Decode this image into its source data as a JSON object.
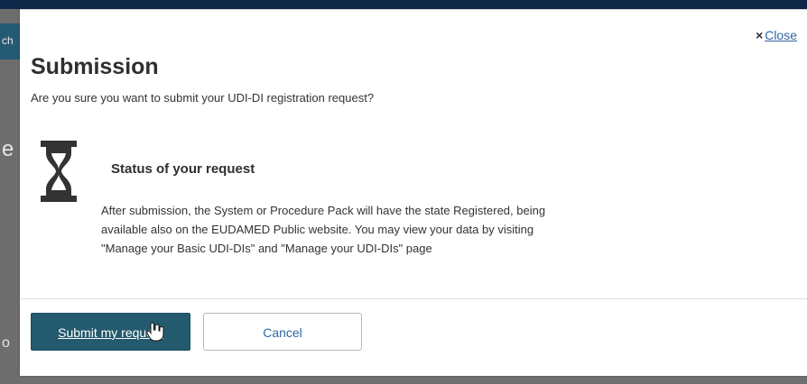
{
  "background": {
    "left_fragments": [
      "ch",
      "e",
      "o"
    ]
  },
  "dialog": {
    "close_label": "Close",
    "title": "Submission",
    "question": "Are you sure you want to submit your UDI-DI registration request?",
    "status": {
      "heading": "Status of your request",
      "lines": [
        "After submission, the System or Procedure Pack will have the state Registered, being",
        "available also on the EUDAMED Public website. You may view your data by visiting",
        "\"Manage your Basic UDI-DIs\" and \"Manage your UDI-DIs\" page"
      ]
    },
    "buttons": {
      "submit_label": "Submit my request",
      "cancel_label": "Cancel"
    }
  },
  "icons": {
    "close": "close-icon",
    "status": "hourglass-icon",
    "cursor": "hand-cursor-icon"
  },
  "colors": {
    "primary_button": "#245a6d",
    "link": "#2f67a5",
    "header_strip": "#0f2748"
  }
}
